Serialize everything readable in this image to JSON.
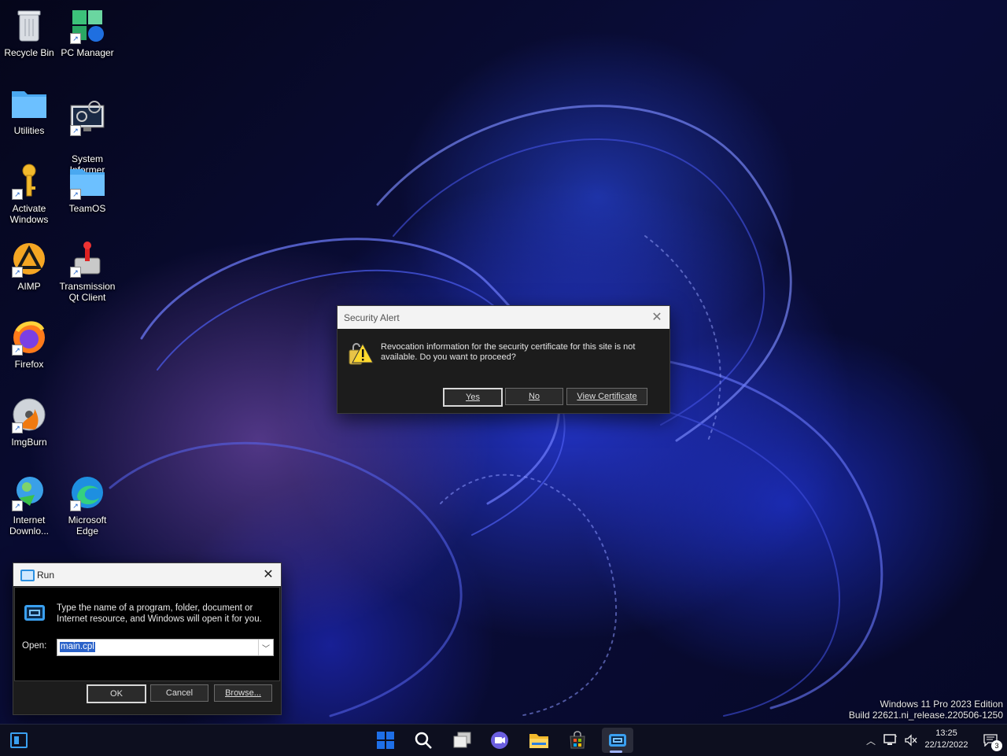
{
  "desktop": {
    "icons": [
      {
        "label": "Recycle Bin",
        "icon": "recycle-bin-icon"
      },
      {
        "label": "PC Manager",
        "icon": "pc-manager-icon"
      },
      {
        "label": "Utilities",
        "icon": "folder-icon"
      },
      {
        "label": "System\nInformer",
        "icon": "system-informer-icon"
      },
      {
        "label": "Activate\nWindows",
        "icon": "key-icon"
      },
      {
        "label": "TeamOS",
        "icon": "folder-icon"
      },
      {
        "label": "AIMP",
        "icon": "aimp-icon"
      },
      {
        "label": "Transmission\nQt Client",
        "icon": "transmission-icon"
      },
      {
        "label": "Firefox",
        "icon": "firefox-icon"
      },
      {
        "label": "ImgBurn",
        "icon": "imgburn-icon"
      },
      {
        "label": "Internet\nDownlo...",
        "icon": "idm-icon"
      },
      {
        "label": "Microsoft\nEdge",
        "icon": "edge-icon"
      }
    ]
  },
  "security_alert": {
    "title": "Security Alert",
    "message_line1": "Revocation information for the security certificate for this site is not",
    "message_line2": "available. Do you want to proceed?",
    "yes": "Yes",
    "no": "No",
    "view_certificate": "View Certificate"
  },
  "run_dialog": {
    "title": "Run",
    "description_line1": "Type the name of a program, folder, document or",
    "description_line2": "Internet resource, and Windows will open it for you.",
    "open_label": "Open:",
    "open_value": "main.cpl",
    "ok": "OK",
    "cancel": "Cancel",
    "browse": "Browse..."
  },
  "watermark": {
    "edition": "Windows 11 Pro 2023 Edition",
    "build": "Build 22621.ni_release.220506-1250"
  },
  "taskbar": {
    "time": "13:25",
    "date": "22/12/2022",
    "notification_count": "3",
    "apps": [
      "windows-start-icon",
      "search-icon",
      "task-view-icon",
      "teams-chat-icon",
      "file-explorer-icon",
      "store-icon",
      "run-icon"
    ]
  }
}
